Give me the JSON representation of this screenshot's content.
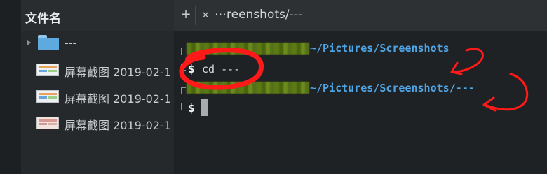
{
  "file_manager": {
    "header": "文件名",
    "rows": [
      {
        "name": "---",
        "kind": "folder",
        "icon": "folder-icon"
      },
      {
        "name": "屏幕截图 2019-02-1",
        "kind": "image",
        "icon": "image-thumbnail"
      },
      {
        "name": "屏幕截图 2019-02-1",
        "kind": "image",
        "icon": "image-thumbnail"
      },
      {
        "name": "屏幕截图 2019-02-1",
        "kind": "image",
        "icon": "image-thumbnail"
      }
    ]
  },
  "terminal": {
    "tab_add_icon": "+",
    "tab_close_icon": "×",
    "tab_title": "⋯reenshots/---",
    "lines": [
      {
        "path": "~/Pictures/Screenshots",
        "prompt": "$",
        "command": "cd ---"
      },
      {
        "path": "~/Pictures/Screenshots/---",
        "prompt": "$",
        "command": ""
      }
    ]
  },
  "colors": {
    "path_blue": "#4fa6e6",
    "annotation_red": "#ff1a1a",
    "redacted_green": "#5c7a12"
  }
}
